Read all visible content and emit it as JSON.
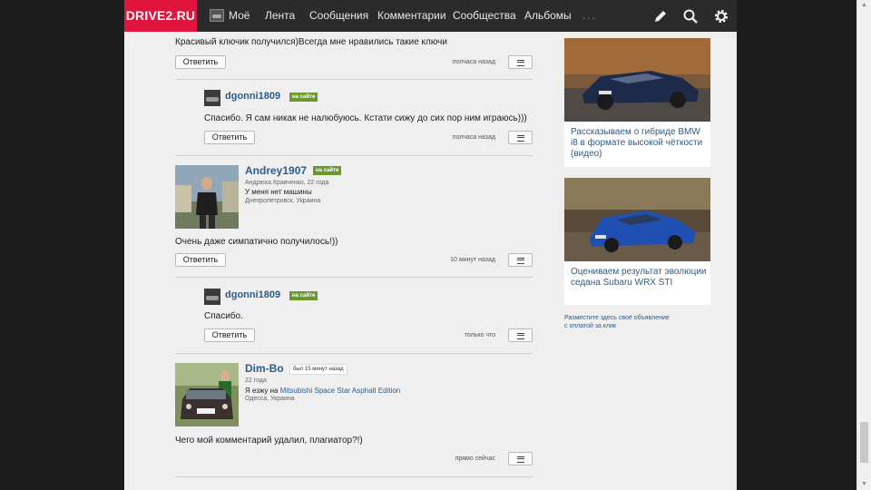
{
  "nav": {
    "logo": "DRIVE2.RU",
    "items": [
      "Моё",
      "Лента",
      "Сообщения",
      "Комментарии",
      "Сообщества",
      "Альбомы",
      "..."
    ]
  },
  "comments": [
    {
      "text": "Красивый ключик получился)Всегда мне нравились такие ключи",
      "reply_label": "Ответить",
      "time": "полчаса назад"
    },
    {
      "username": "dgonni1809",
      "status": "на сайте",
      "text": "Спасибо. Я сам никак не налюбуюсь. Кстати сижу до сих пор ним играюсь)))",
      "reply_label": "Ответить",
      "time": "полчаса назад"
    },
    {
      "username": "Andrey1907",
      "status": "на сайте",
      "fullname_age": "Андрюха Кравченко, 22 года",
      "car": "У меня нет машины",
      "location": "Днепропетровск, Украина",
      "text": "Очень даже симпатично получилось!))",
      "reply_label": "Ответить",
      "time": "10 минут назад"
    },
    {
      "username": "dgonni1809",
      "status": "на сайте",
      "text": "Спасибо.",
      "reply_label": "Ответить",
      "time": "только что"
    },
    {
      "username": "Dim-Bo",
      "status": "был 15 минут назад",
      "age": "22 года",
      "car_prefix": "Я езжу на ",
      "car_link": "Mitsubishi Space Star Asphalt Edition",
      "location": "Одесса, Украина",
      "text": "Чего мой комментарий удалил, плагиатор?!)",
      "time": "прямо сейчас"
    }
  ],
  "sidebar": {
    "ads": [
      {
        "text": "Рассказываем о гибриде BMW i8 в формате высокой чёткости (видео)",
        "image": "bmw-i8-photo"
      },
      {
        "text": "Оцениваем результат эволюции седана Subaru WRX STI",
        "image": "subaru-wrx-photo"
      }
    ],
    "note_line1": "Разместите здесь своё объявление",
    "note_line2": "с оплатой за клик"
  },
  "colors": {
    "brand": "#e0143c",
    "link": "#2b5c8a",
    "online": "#6a9a2a",
    "nav_bg": "#2b2b2b"
  }
}
